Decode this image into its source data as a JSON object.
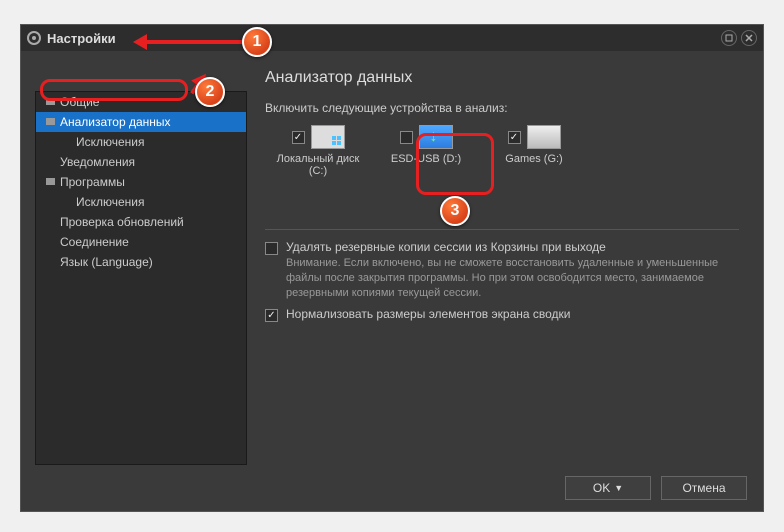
{
  "window": {
    "title": "Настройки"
  },
  "sidebar": {
    "items": [
      {
        "label": "Общие",
        "hasIcon": true
      },
      {
        "label": "Анализатор данных",
        "hasIcon": true,
        "selected": true
      },
      {
        "label": "Исключения",
        "indent": true
      },
      {
        "label": "Уведомления"
      },
      {
        "label": "Программы",
        "hasIcon": true
      },
      {
        "label": "Исключения",
        "indent": true
      },
      {
        "label": "Проверка обновлений"
      },
      {
        "label": "Соединение"
      },
      {
        "label": "Язык (Language)"
      }
    ]
  },
  "content": {
    "heading": "Анализатор данных",
    "include_label": "Включить следующие устройства в анализ:",
    "drives": [
      {
        "name": "Локальный диск (C:)",
        "checked": true,
        "iconType": "win"
      },
      {
        "name": "ESD-USB (D:)",
        "checked": false,
        "iconType": "usb"
      },
      {
        "name": "Games (G:)",
        "checked": true,
        "iconType": "hdd"
      }
    ],
    "delete_backups": {
      "checked": false,
      "label": "Удалять резервные копии сессии из Корзины при выходе",
      "note": "Внимание. Если включено, вы не сможете восстановить удаленные и уменьшенные файлы после закрытия программы. Но при этом освободится место, занимаемое резервными копиями текущей сессии."
    },
    "normalize": {
      "checked": true,
      "label": "Нормализовать размеры элементов экрана сводки"
    }
  },
  "footer": {
    "ok": "OK",
    "cancel": "Отмена"
  },
  "callouts": {
    "n1": "1",
    "n2": "2",
    "n3": "3"
  }
}
